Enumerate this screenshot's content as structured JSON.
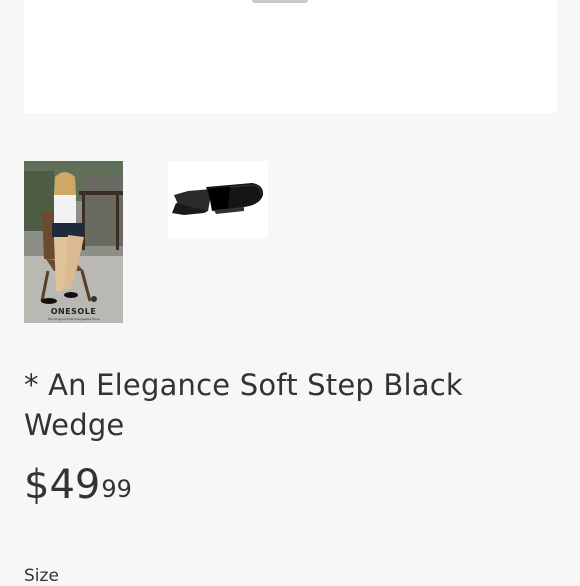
{
  "gallery": {
    "main_image_alt": "product-image",
    "thumbnails": [
      {
        "name": "lifestyle-photo",
        "brand_text": "ONESOLE",
        "tagline": "The Original Interchangeable Shoe"
      },
      {
        "name": "black-wedge-sandal-photo"
      }
    ]
  },
  "product": {
    "title": "* An Elegance Soft Step Black Wedge",
    "price_dollars": "$49",
    "price_cents": "99",
    "size_label": "Size"
  },
  "colors": {
    "page_background": "#f7f7f7",
    "text": "#333333"
  }
}
